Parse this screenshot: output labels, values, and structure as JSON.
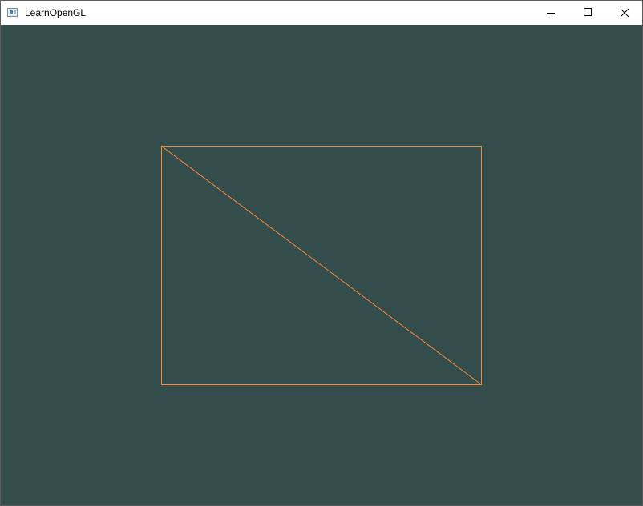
{
  "window": {
    "title": "LearnOpenGL",
    "icon": "app-window-icon"
  },
  "titlebar_buttons": {
    "minimize_icon": "minimize-icon",
    "maximize_icon": "maximize-icon",
    "close_icon": "close-icon"
  },
  "render": {
    "clear_color": "#334c4c",
    "line_color": "#ff8a33",
    "mode": "wireframe",
    "shape": "rectangle made of two triangles"
  },
  "colors": {
    "titlebar": "#ffffff",
    "title_text": "#000000",
    "window_border": "#5a5a5a"
  }
}
